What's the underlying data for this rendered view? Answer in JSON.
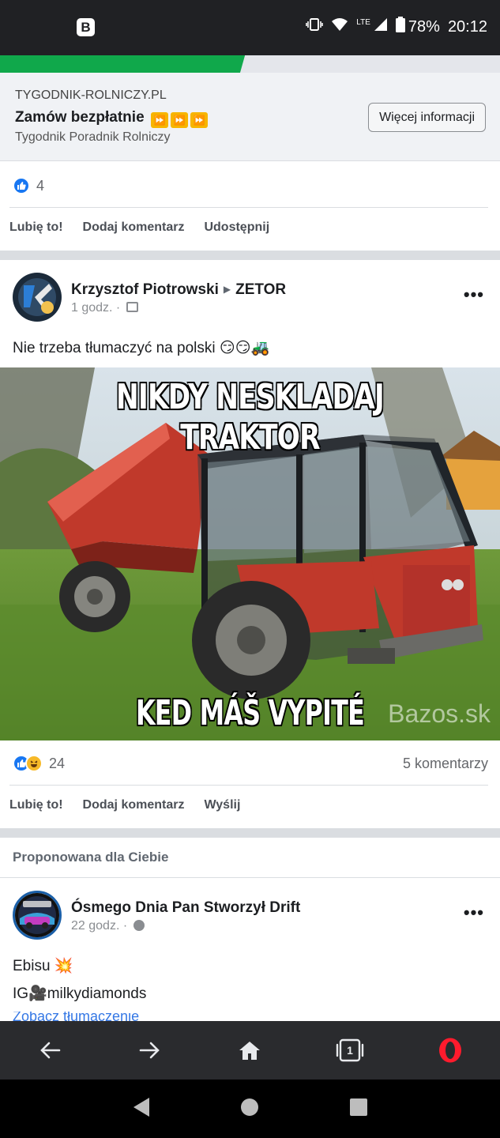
{
  "status_bar": {
    "battery": "78%",
    "time": "20:12",
    "network": "LTE",
    "app_icon": "B"
  },
  "load_progress": 0.49,
  "ad": {
    "domain": "TYGODNIK-ROLNICZY.PL",
    "title": "Zamów bezpłatnie",
    "title_emoji": "⏩",
    "subtitle": "Tygodnik Poradnik Rolniczy",
    "button": "Więcej informacji"
  },
  "ad_reactions": {
    "count": "4"
  },
  "ad_actions": {
    "like": "Lubię to!",
    "comment": "Dodaj komentarz",
    "share": "Udostępnij"
  },
  "post": {
    "author": "Krzysztof Piotrowski",
    "group": "ZETOR",
    "time": "1 godz. ·",
    "text": "Nie trzeba tłumaczyć na polski 😏😏🚜",
    "image": {
      "top_caption": "NIKDY NESKLADAJ TRAKTOR",
      "bottom_caption": "KED MÁŠ VYPITÉ",
      "watermark": "Bazos.sk"
    },
    "reactions_count": "24",
    "comments": "5 komentarzy",
    "actions": {
      "like": "Lubię to!",
      "comment": "Dodaj komentarz",
      "send": "Wyślij"
    }
  },
  "suggested_label": "Proponowana dla Ciebie",
  "post2": {
    "author": "Ósmego Dnia Pan Stworzył Drift",
    "time": "22 godz. ·",
    "line1": "Ebisu 💥",
    "line2": "IG🎥milkydiamonds",
    "see_translation": "Zobacz tłumaczenie"
  },
  "icons": {
    "back": "arrow-left-icon",
    "forward": "arrow-right-icon",
    "home": "home-icon",
    "tabs": "tabs-icon",
    "tabs_count": "1",
    "opera": "opera-icon"
  }
}
